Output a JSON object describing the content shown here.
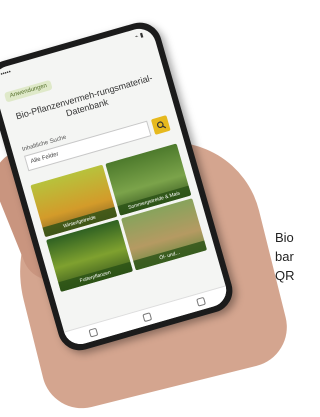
{
  "phone": {
    "status": {
      "carrier": "•••••",
      "time": "",
      "icons": "⌁ ▮"
    },
    "breadcrumb": "Anwendungen",
    "title": "Bio-Pflanzenvermeh-rungsmaterial-Datenbank",
    "search": {
      "label": "Inhaltliche Suche",
      "placeholder": "Alle Felder",
      "button_icon": "search-icon"
    },
    "tiles": [
      {
        "label": "Winterlgetreide"
      },
      {
        "label": "Sommergetreide & Mais"
      },
      {
        "label": "Futterpflanzen"
      },
      {
        "label": "Öl- und…"
      }
    ],
    "nav_icons": [
      "home-icon",
      "grid-icon",
      "menu-icon"
    ]
  },
  "side_text": [
    "Bio",
    "bar",
    "QR"
  ]
}
